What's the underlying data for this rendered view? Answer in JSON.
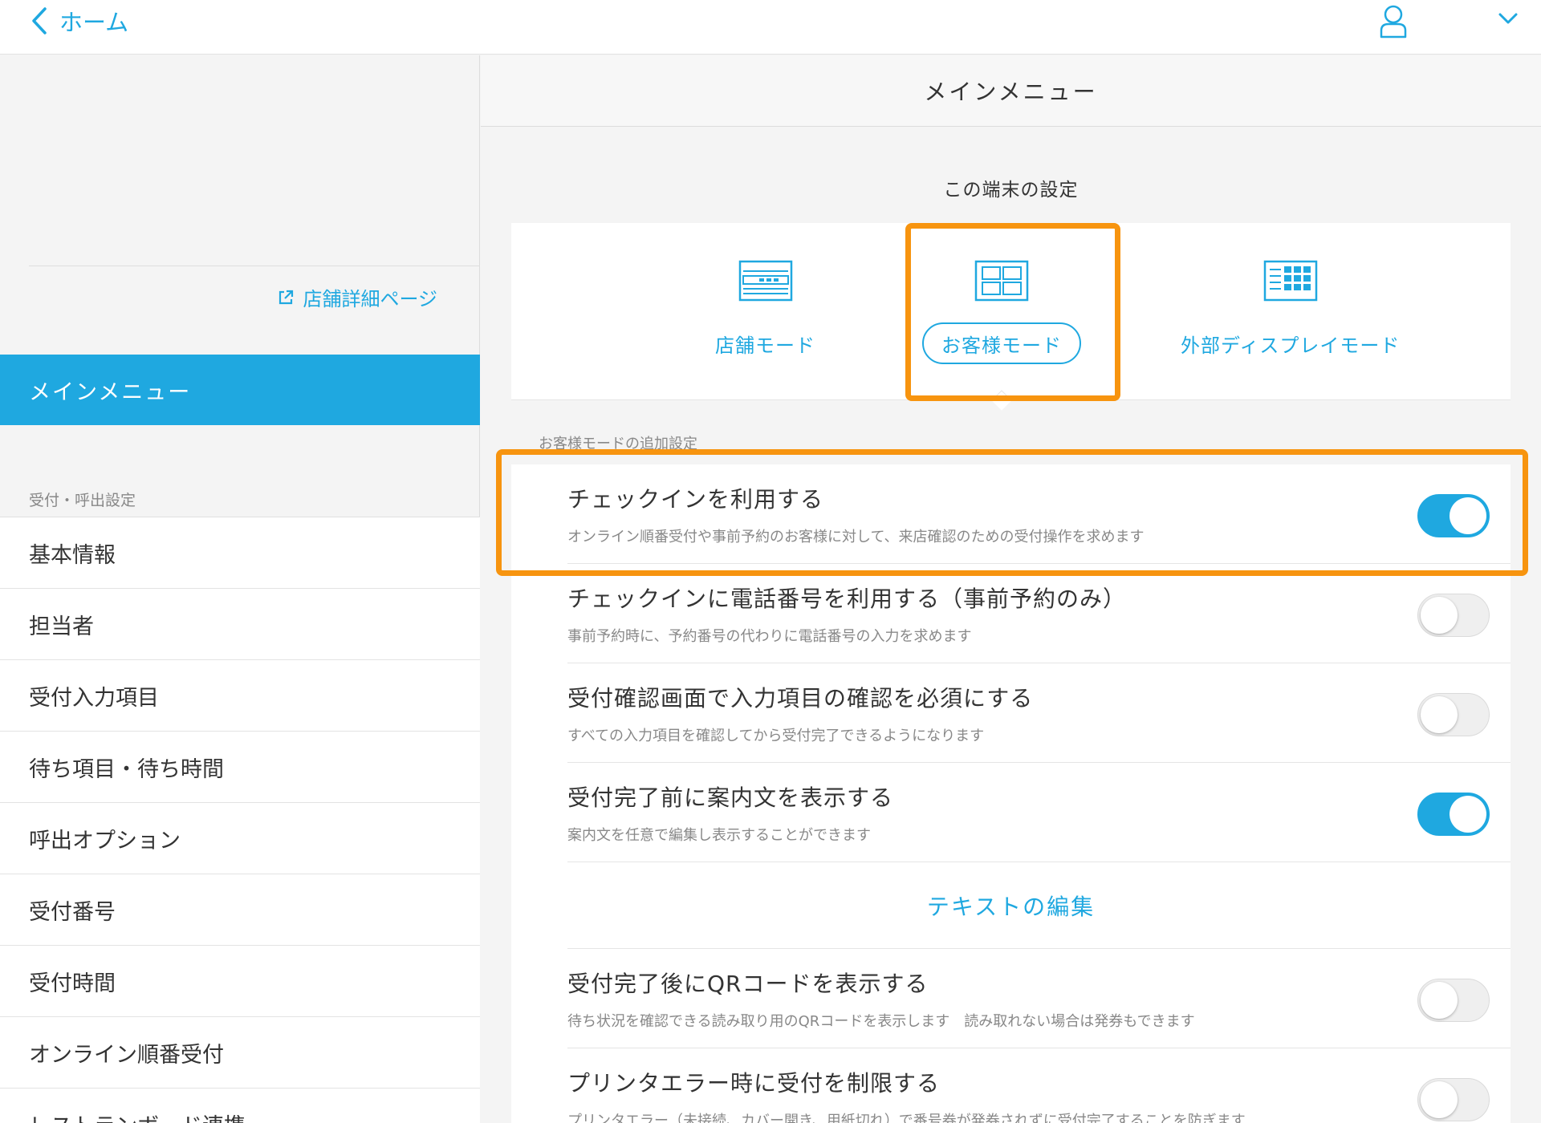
{
  "topbar": {
    "back_label": "ホーム"
  },
  "sidebar": {
    "store_link": "店舗詳細ページ",
    "active_item": "メインメニュー",
    "section_label": "受付・呼出設定",
    "items": [
      "基本情報",
      "担当者",
      "受付入力項目",
      "待ち項目・待ち時間",
      "呼出オプション",
      "受付番号",
      "受付時間",
      "オンライン順番受付",
      "レストランボード連携"
    ]
  },
  "main": {
    "header_title": "メインメニュー",
    "device_title": "この端末の設定",
    "modes": [
      {
        "label": "店舗モード",
        "icon": "store-mode-icon",
        "selected": false
      },
      {
        "label": "お客様モード",
        "icon": "customer-mode-icon",
        "selected": true
      },
      {
        "label": "外部ディスプレイモード",
        "icon": "external-display-icon",
        "selected": false
      }
    ],
    "sub_title": "お客様モードの追加設定",
    "settings": [
      {
        "title": "チェックインを利用する",
        "desc": "オンライン順番受付や事前予約のお客様に対して、来店確認のための受付操作を求めます",
        "on": true
      },
      {
        "title": "チェックインに電話番号を利用する（事前予約のみ）",
        "desc": "事前予約時に、予約番号の代わりに電話番号の入力を求めます",
        "on": false
      },
      {
        "title": "受付確認画面で入力項目の確認を必須にする",
        "desc": "すべての入力項目を確認してから受付完了できるようになります",
        "on": false
      },
      {
        "title": "受付完了前に案内文を表示する",
        "desc": "案内文を任意で編集し表示することができます",
        "on": true
      }
    ],
    "edit_text": "テキストの編集",
    "settings2": [
      {
        "title": "受付完了後にQRコードを表示する",
        "desc": "待ち状況を確認できる読み取り用のQRコードを表示します　読み取れない場合は発券もできます",
        "on": false
      },
      {
        "title": "プリンタエラー時に受付を制限する",
        "desc": "プリンタエラー（未接続、カバー開き、用紙切れ）で番号券が発券されずに受付完了することを防ぎます",
        "on": false
      }
    ]
  },
  "colors": {
    "accent": "#1fa8e0",
    "highlight": "#f7940f"
  }
}
